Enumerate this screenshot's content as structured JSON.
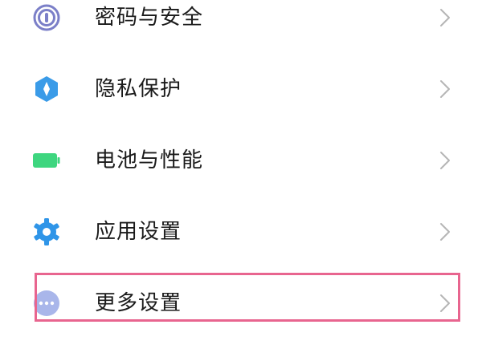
{
  "settings_list": {
    "items": [
      {
        "label": "密码与安全",
        "icon": "fingerprint-icon",
        "color": "#7b7fc8"
      },
      {
        "label": "隐私保护",
        "icon": "privacy-shield-icon",
        "color": "#3a9be8"
      },
      {
        "label": "电池与性能",
        "icon": "battery-icon",
        "color": "#3ed67f"
      },
      {
        "label": "应用设置",
        "icon": "gear-icon",
        "color": "#2f95e8"
      },
      {
        "label": "更多设置",
        "icon": "more-dots-icon",
        "color": "#a9b6ea"
      }
    ],
    "highlight_color": "#e8658f"
  }
}
